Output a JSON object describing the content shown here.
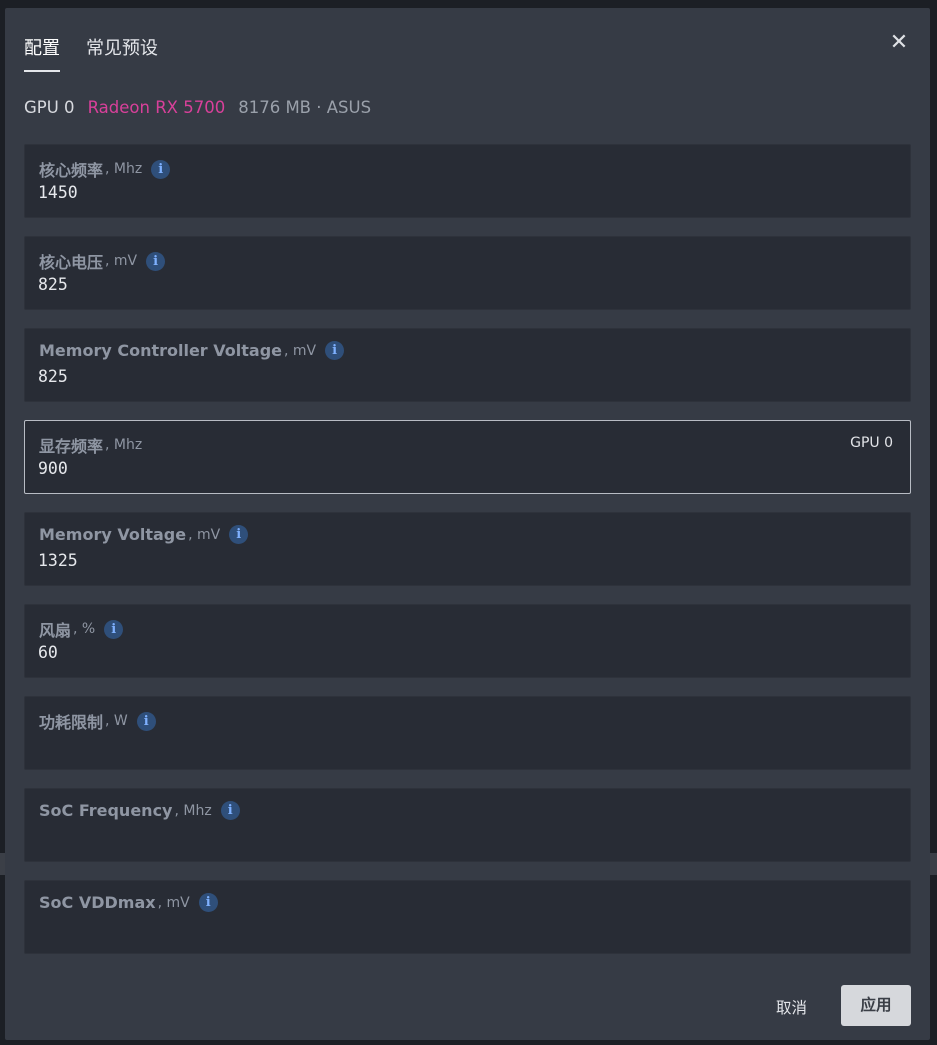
{
  "tabs": [
    {
      "label": "配置",
      "active": true
    },
    {
      "label": "常见预设",
      "active": false
    }
  ],
  "close_symbol": "✕",
  "gpu": {
    "id": "GPU 0",
    "name": "Radeon RX 5700",
    "meta": "8176 MB · ASUS"
  },
  "fields": [
    {
      "label": "核心频率",
      "unit": ", Mhz",
      "value": "1450",
      "info": true
    },
    {
      "label": "核心电压",
      "unit": ", mV",
      "value": "825",
      "info": true
    },
    {
      "label": "Memory Controller Voltage",
      "unit": ", mV",
      "value": "825",
      "info": true
    },
    {
      "label": "显存频率",
      "unit": ", Mhz",
      "value": "900",
      "info": false,
      "tag": "GPU 0"
    },
    {
      "label": "Memory Voltage",
      "unit": ", mV",
      "value": "1325",
      "info": true
    },
    {
      "label": "风扇",
      "unit": ", %",
      "value": "60",
      "info": true
    },
    {
      "label": "功耗限制",
      "unit": ", W",
      "value": "",
      "info": true
    },
    {
      "label": "SoC Frequency",
      "unit": ", Mhz",
      "value": "",
      "info": true
    },
    {
      "label": "SoC VDDmax",
      "unit": ", mV",
      "value": "",
      "info": true
    }
  ],
  "info_glyph": "i",
  "footer": {
    "cancel_label": "取消",
    "apply_label": "应用"
  },
  "colors": {
    "modal_bg": "#363b45",
    "field_bg": "#282c35",
    "accent_gpu_name": "#d8409a",
    "info_icon": "#7fb1ff"
  }
}
